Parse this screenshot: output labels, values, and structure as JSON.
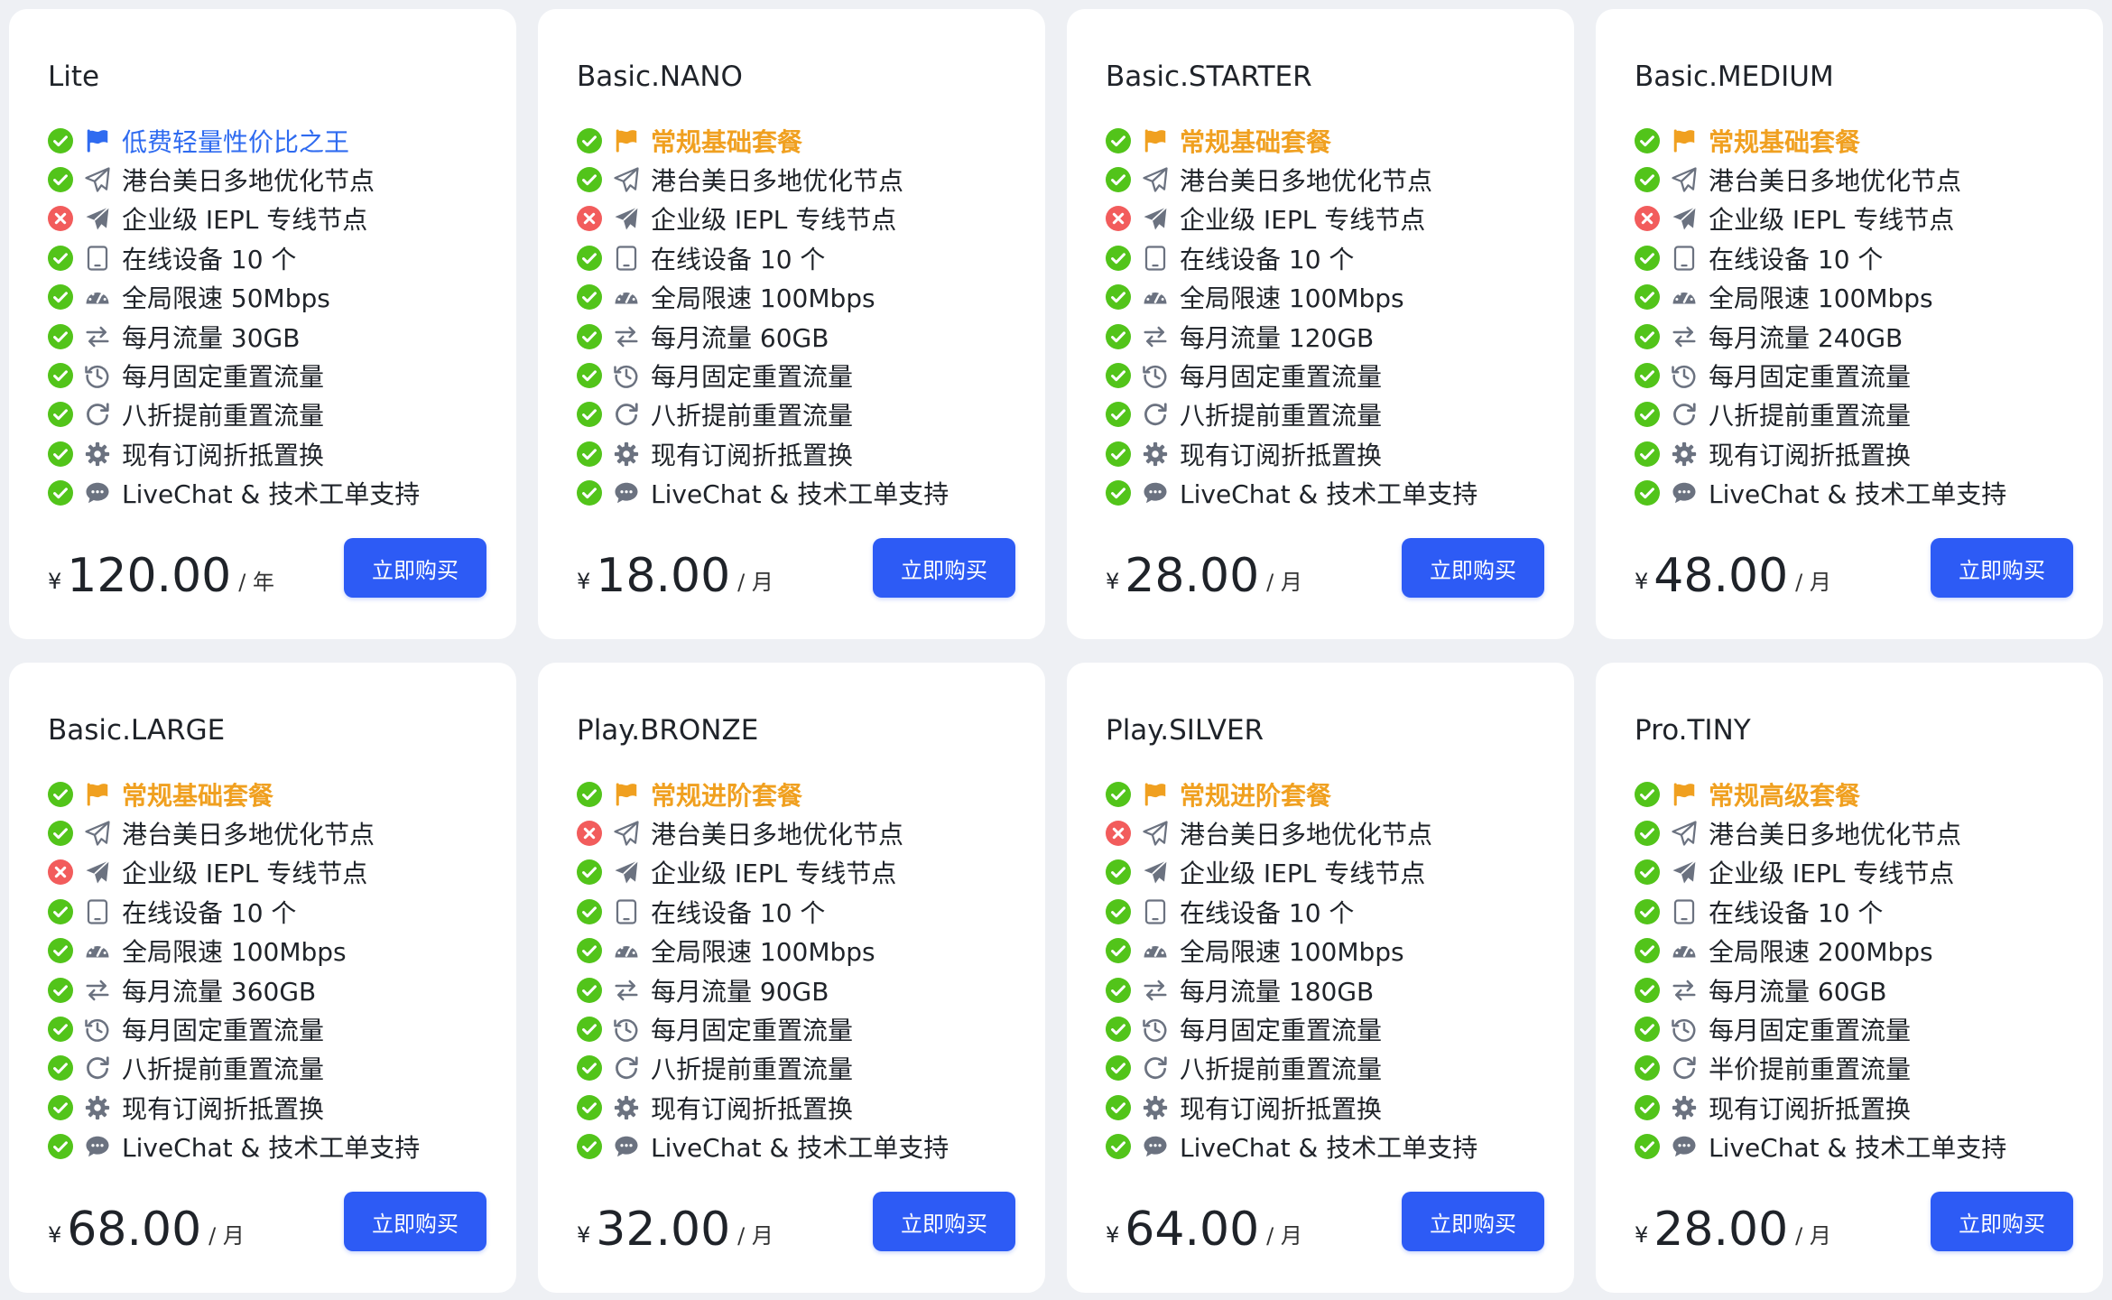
{
  "buy_label": "立即购买",
  "currency_symbol": "¥",
  "colors": {
    "accent_blue": "#2f6bf0",
    "accent_orange": "#f0a020",
    "check_green": "#52c41a",
    "cross_red": "#f25c5c",
    "button_blue": "#2d5bf5"
  },
  "plans": [
    {
      "name": "Lite",
      "price": "120.00",
      "period": "/ 年",
      "features": [
        {
          "status": "check",
          "icon": "flag-icon",
          "text": "低费轻量性价比之王",
          "style": "hl-blue"
        },
        {
          "status": "check",
          "icon": "paper-plane-outline-icon",
          "text": "港台美日多地优化节点"
        },
        {
          "status": "cross",
          "icon": "paper-plane-solid-icon",
          "text": "企业级 IEPL 专线节点"
        },
        {
          "status": "check",
          "icon": "tablet-icon",
          "text": "在线设备 10 个"
        },
        {
          "status": "check",
          "icon": "speedometer-icon",
          "text": "全局限速 50Mbps"
        },
        {
          "status": "check",
          "icon": "exchange-icon",
          "text": "每月流量 30GB"
        },
        {
          "status": "check",
          "icon": "history-icon",
          "text": "每月固定重置流量"
        },
        {
          "status": "check",
          "icon": "redo-icon",
          "text": "八折提前重置流量"
        },
        {
          "status": "check",
          "icon": "gear-icon",
          "text": "现有订阅折抵置换"
        },
        {
          "status": "check",
          "icon": "chat-icon",
          "text": "LiveChat & 技术工单支持"
        }
      ]
    },
    {
      "name": "Basic.NANO",
      "price": "18.00",
      "period": "/ 月",
      "features": [
        {
          "status": "check",
          "icon": "flag-icon",
          "text": "常规基础套餐",
          "style": "hl-orange"
        },
        {
          "status": "check",
          "icon": "paper-plane-outline-icon",
          "text": "港台美日多地优化节点"
        },
        {
          "status": "cross",
          "icon": "paper-plane-solid-icon",
          "text": "企业级 IEPL 专线节点"
        },
        {
          "status": "check",
          "icon": "tablet-icon",
          "text": "在线设备 10 个"
        },
        {
          "status": "check",
          "icon": "speedometer-icon",
          "text": "全局限速 100Mbps"
        },
        {
          "status": "check",
          "icon": "exchange-icon",
          "text": "每月流量 60GB"
        },
        {
          "status": "check",
          "icon": "history-icon",
          "text": "每月固定重置流量"
        },
        {
          "status": "check",
          "icon": "redo-icon",
          "text": "八折提前重置流量"
        },
        {
          "status": "check",
          "icon": "gear-icon",
          "text": "现有订阅折抵置换"
        },
        {
          "status": "check",
          "icon": "chat-icon",
          "text": "LiveChat & 技术工单支持"
        }
      ]
    },
    {
      "name": "Basic.STARTER",
      "price": "28.00",
      "period": "/ 月",
      "features": [
        {
          "status": "check",
          "icon": "flag-icon",
          "text": "常规基础套餐",
          "style": "hl-orange"
        },
        {
          "status": "check",
          "icon": "paper-plane-outline-icon",
          "text": "港台美日多地优化节点"
        },
        {
          "status": "cross",
          "icon": "paper-plane-solid-icon",
          "text": "企业级 IEPL 专线节点"
        },
        {
          "status": "check",
          "icon": "tablet-icon",
          "text": "在线设备 10 个"
        },
        {
          "status": "check",
          "icon": "speedometer-icon",
          "text": "全局限速 100Mbps"
        },
        {
          "status": "check",
          "icon": "exchange-icon",
          "text": "每月流量 120GB"
        },
        {
          "status": "check",
          "icon": "history-icon",
          "text": "每月固定重置流量"
        },
        {
          "status": "check",
          "icon": "redo-icon",
          "text": "八折提前重置流量"
        },
        {
          "status": "check",
          "icon": "gear-icon",
          "text": "现有订阅折抵置换"
        },
        {
          "status": "check",
          "icon": "chat-icon",
          "text": "LiveChat & 技术工单支持"
        }
      ]
    },
    {
      "name": "Basic.MEDIUM",
      "price": "48.00",
      "period": "/ 月",
      "features": [
        {
          "status": "check",
          "icon": "flag-icon",
          "text": "常规基础套餐",
          "style": "hl-orange"
        },
        {
          "status": "check",
          "icon": "paper-plane-outline-icon",
          "text": "港台美日多地优化节点"
        },
        {
          "status": "cross",
          "icon": "paper-plane-solid-icon",
          "text": "企业级 IEPL 专线节点"
        },
        {
          "status": "check",
          "icon": "tablet-icon",
          "text": "在线设备 10 个"
        },
        {
          "status": "check",
          "icon": "speedometer-icon",
          "text": "全局限速 100Mbps"
        },
        {
          "status": "check",
          "icon": "exchange-icon",
          "text": "每月流量 240GB"
        },
        {
          "status": "check",
          "icon": "history-icon",
          "text": "每月固定重置流量"
        },
        {
          "status": "check",
          "icon": "redo-icon",
          "text": "八折提前重置流量"
        },
        {
          "status": "check",
          "icon": "gear-icon",
          "text": "现有订阅折抵置换"
        },
        {
          "status": "check",
          "icon": "chat-icon",
          "text": "LiveChat & 技术工单支持"
        }
      ]
    },
    {
      "name": "Basic.LARGE",
      "price": "68.00",
      "period": "/ 月",
      "features": [
        {
          "status": "check",
          "icon": "flag-icon",
          "text": "常规基础套餐",
          "style": "hl-orange"
        },
        {
          "status": "check",
          "icon": "paper-plane-outline-icon",
          "text": "港台美日多地优化节点"
        },
        {
          "status": "cross",
          "icon": "paper-plane-solid-icon",
          "text": "企业级 IEPL 专线节点"
        },
        {
          "status": "check",
          "icon": "tablet-icon",
          "text": "在线设备 10 个"
        },
        {
          "status": "check",
          "icon": "speedometer-icon",
          "text": "全局限速 100Mbps"
        },
        {
          "status": "check",
          "icon": "exchange-icon",
          "text": "每月流量 360GB"
        },
        {
          "status": "check",
          "icon": "history-icon",
          "text": "每月固定重置流量"
        },
        {
          "status": "check",
          "icon": "redo-icon",
          "text": "八折提前重置流量"
        },
        {
          "status": "check",
          "icon": "gear-icon",
          "text": "现有订阅折抵置换"
        },
        {
          "status": "check",
          "icon": "chat-icon",
          "text": "LiveChat & 技术工单支持"
        }
      ]
    },
    {
      "name": "Play.BRONZE",
      "price": "32.00",
      "period": "/ 月",
      "features": [
        {
          "status": "check",
          "icon": "flag-icon",
          "text": "常规进阶套餐",
          "style": "hl-orange"
        },
        {
          "status": "cross",
          "icon": "paper-plane-outline-icon",
          "text": "港台美日多地优化节点"
        },
        {
          "status": "check",
          "icon": "paper-plane-solid-icon",
          "text": "企业级 IEPL 专线节点"
        },
        {
          "status": "check",
          "icon": "tablet-icon",
          "text": "在线设备 10 个"
        },
        {
          "status": "check",
          "icon": "speedometer-icon",
          "text": "全局限速 100Mbps"
        },
        {
          "status": "check",
          "icon": "exchange-icon",
          "text": "每月流量 90GB"
        },
        {
          "status": "check",
          "icon": "history-icon",
          "text": "每月固定重置流量"
        },
        {
          "status": "check",
          "icon": "redo-icon",
          "text": "八折提前重置流量"
        },
        {
          "status": "check",
          "icon": "gear-icon",
          "text": "现有订阅折抵置换"
        },
        {
          "status": "check",
          "icon": "chat-icon",
          "text": "LiveChat & 技术工单支持"
        }
      ]
    },
    {
      "name": "Play.SILVER",
      "price": "64.00",
      "period": "/ 月",
      "features": [
        {
          "status": "check",
          "icon": "flag-icon",
          "text": "常规进阶套餐",
          "style": "hl-orange"
        },
        {
          "status": "cross",
          "icon": "paper-plane-outline-icon",
          "text": "港台美日多地优化节点"
        },
        {
          "status": "check",
          "icon": "paper-plane-solid-icon",
          "text": "企业级 IEPL 专线节点"
        },
        {
          "status": "check",
          "icon": "tablet-icon",
          "text": "在线设备 10 个"
        },
        {
          "status": "check",
          "icon": "speedometer-icon",
          "text": "全局限速 100Mbps"
        },
        {
          "status": "check",
          "icon": "exchange-icon",
          "text": "每月流量 180GB"
        },
        {
          "status": "check",
          "icon": "history-icon",
          "text": "每月固定重置流量"
        },
        {
          "status": "check",
          "icon": "redo-icon",
          "text": "八折提前重置流量"
        },
        {
          "status": "check",
          "icon": "gear-icon",
          "text": "现有订阅折抵置换"
        },
        {
          "status": "check",
          "icon": "chat-icon",
          "text": "LiveChat & 技术工单支持"
        }
      ]
    },
    {
      "name": "Pro.TINY",
      "price": "28.00",
      "period": "/ 月",
      "features": [
        {
          "status": "check",
          "icon": "flag-icon",
          "text": "常规高级套餐",
          "style": "hl-orange"
        },
        {
          "status": "check",
          "icon": "paper-plane-outline-icon",
          "text": "港台美日多地优化节点"
        },
        {
          "status": "check",
          "icon": "paper-plane-solid-icon",
          "text": "企业级 IEPL 专线节点"
        },
        {
          "status": "check",
          "icon": "tablet-icon",
          "text": "在线设备 10 个"
        },
        {
          "status": "check",
          "icon": "speedometer-icon",
          "text": "全局限速 200Mbps"
        },
        {
          "status": "check",
          "icon": "exchange-icon",
          "text": "每月流量 60GB"
        },
        {
          "status": "check",
          "icon": "history-icon",
          "text": "每月固定重置流量"
        },
        {
          "status": "check",
          "icon": "redo-icon",
          "text": "半价提前重置流量"
        },
        {
          "status": "check",
          "icon": "gear-icon",
          "text": "现有订阅折抵置换"
        },
        {
          "status": "check",
          "icon": "chat-icon",
          "text": "LiveChat & 技术工单支持"
        }
      ]
    }
  ]
}
